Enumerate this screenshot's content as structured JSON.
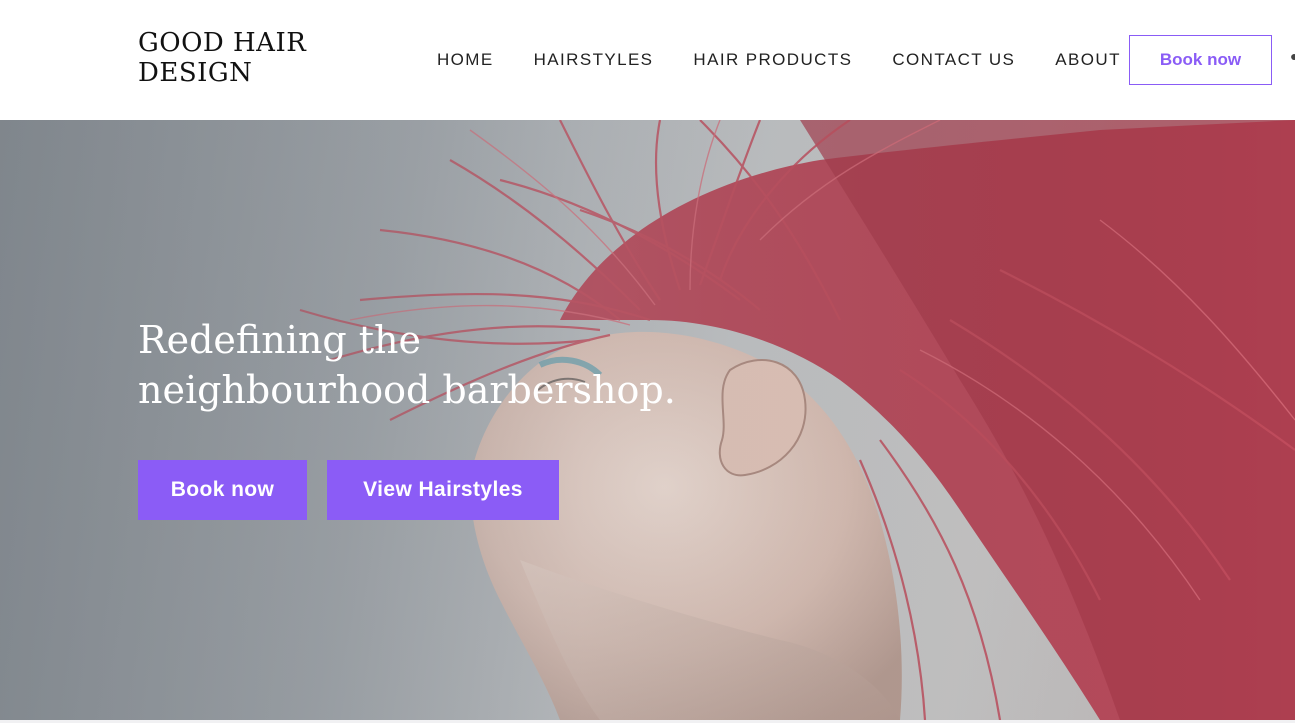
{
  "header": {
    "logo_line1": "GOOD HAIR",
    "logo_line2": "DESIGN",
    "nav": [
      "HOME",
      "HAIRSTYLES",
      "HAIR PRODUCTS",
      "CONTACT US",
      "ABOUT"
    ],
    "book_label": "Book now"
  },
  "hero": {
    "title": "Redefining the neighbourhood barbershop.",
    "primary_button": "Book now",
    "secondary_button": "View Hairstyles",
    "image_description_icon": "hero-photo-red-hair"
  },
  "colors": {
    "accent": "#8b5cf6",
    "text_dark": "#222222",
    "hero_text": "#ffffff",
    "hair": "#c24e5e"
  }
}
